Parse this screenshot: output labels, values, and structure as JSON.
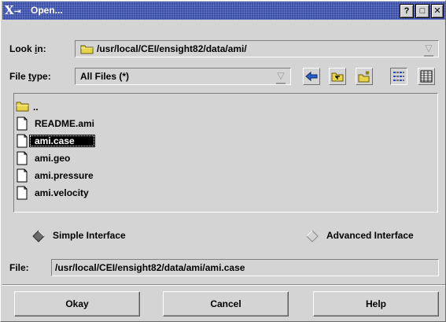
{
  "window": {
    "logo": "X",
    "title": "Open...",
    "help_btn": "?",
    "max_btn": "□",
    "close_btn": "✕"
  },
  "look_in": {
    "label_pre": "Look ",
    "label_key": "i",
    "label_post": "n:",
    "value": "/usr/local/CEI/ensight82/data/ami/"
  },
  "file_type": {
    "label_pre": "File ",
    "label_key": "t",
    "label_post": "ype:",
    "value": "All Files (*)"
  },
  "toolbar": {
    "icons": [
      "back-arrow-icon",
      "parent-folder-icon",
      "new-folder-icon",
      "list-view-icon",
      "detail-view-icon"
    ]
  },
  "files": [
    {
      "name": "..",
      "icon": "folder-icon",
      "selected": false
    },
    {
      "name": "README.ami",
      "icon": "document-icon",
      "selected": false
    },
    {
      "name": "ami.case",
      "icon": "document-icon",
      "selected": true
    },
    {
      "name": "ami.geo",
      "icon": "document-icon",
      "selected": false
    },
    {
      "name": "ami.pressure",
      "icon": "document-icon",
      "selected": false
    },
    {
      "name": "ami.velocity",
      "icon": "document-icon",
      "selected": false
    }
  ],
  "interface": {
    "simple": "Simple Interface",
    "advanced": "Advanced Interface",
    "selected": "simple"
  },
  "file_field": {
    "label": "File:",
    "value": "/usr/local/CEI/ensight82/data/ami/ami.case"
  },
  "buttons": {
    "okay": "Okay",
    "cancel": "Cancel",
    "help": "Help"
  },
  "colors": {
    "titlebar": "#3a4ea6",
    "dialog_bg": "#d4d4d4",
    "folder": "#e8d44a",
    "back_arrow": "#2a5fd0"
  }
}
